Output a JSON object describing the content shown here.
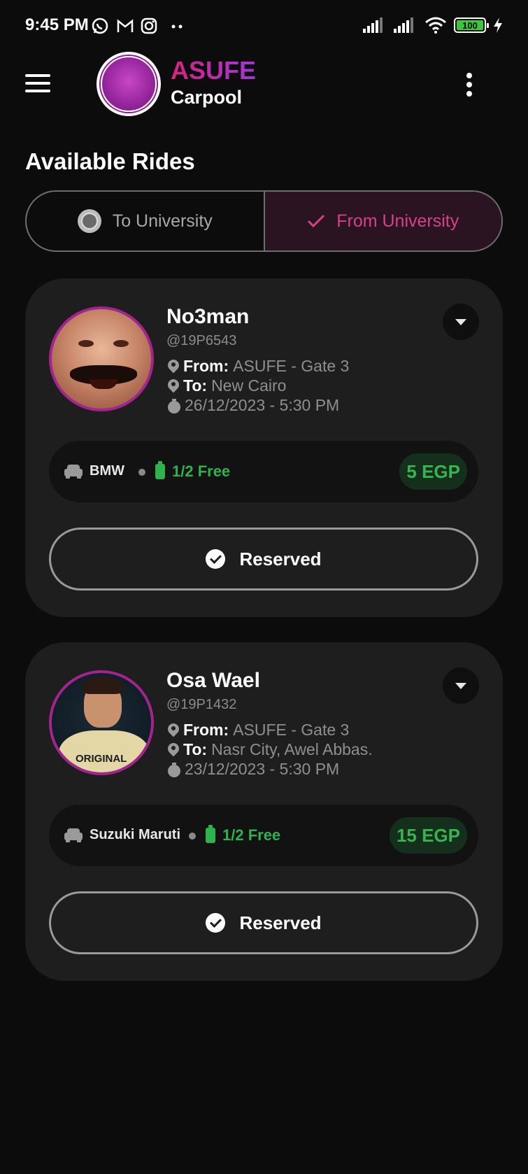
{
  "status_bar": {
    "time": "9:45 PM",
    "left_icons": [
      "whatsapp-icon",
      "gmail-icon",
      "instagram-icon",
      "more-notifications-icon"
    ],
    "right_icons": [
      "signal-icon",
      "signal-icon",
      "wifi-icon",
      "battery-icon",
      "charging-icon"
    ],
    "battery_level": "100"
  },
  "app_bar": {
    "brand_title": "ASUFE",
    "brand_subtitle": "Carpool",
    "brand_colors": [
      "#d6247e",
      "#9f36d8"
    ]
  },
  "page": {
    "section_title": "Available Rides"
  },
  "tabs": [
    {
      "label": "To University",
      "selected": false,
      "icon": "university-icon"
    },
    {
      "label": "From University",
      "selected": true,
      "icon": "checkmark-icon",
      "accent": "#d8418a"
    }
  ],
  "rides": [
    {
      "name": "No3man",
      "handle": "@19P6543",
      "from_label": "From:",
      "from": "ASUFE - Gate 3",
      "to_label": "To:",
      "to": "New Cairo",
      "datetime": "26/12/2023 - 5:30 PM",
      "car": "BMW",
      "seats": "1/2 Free",
      "price": "5 EGP",
      "action": "Reserved"
    },
    {
      "name": "Osa Wael",
      "handle": "@19P1432",
      "from_label": "From:",
      "from": "ASUFE - Gate 3",
      "to_label": "To:",
      "to": "Nasr City, Awel Abbas.",
      "datetime": "23/12/2023 - 5:30 PM",
      "car": "Suzuki Maruti",
      "seats": "1/2 Free",
      "price": "15 EGP",
      "action": "Reserved",
      "avatar_shirt_text": "ORIGINAL"
    }
  ],
  "colors": {
    "background": "#0c0c0c",
    "card": "#1e1e1e",
    "free_seats": "#2fb14c",
    "price": "#36b44f"
  }
}
